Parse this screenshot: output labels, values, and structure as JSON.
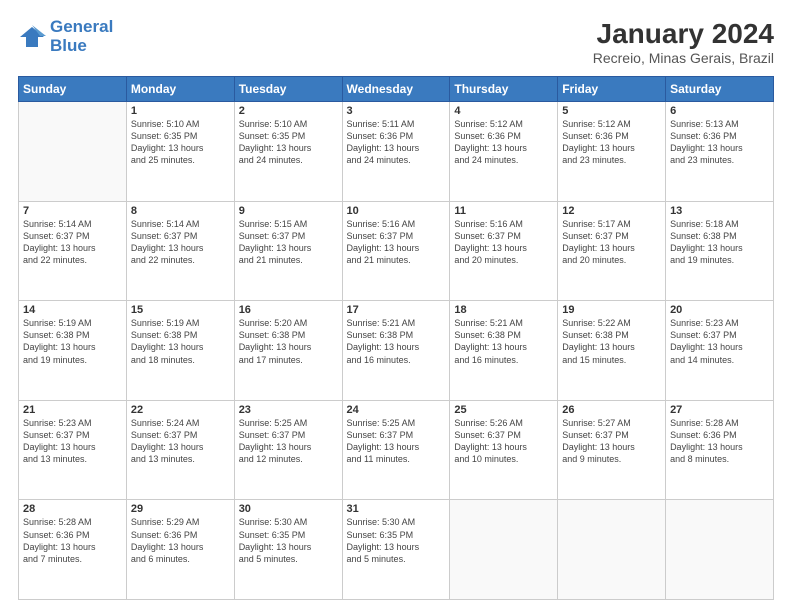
{
  "logo": {
    "line1": "General",
    "line2": "Blue"
  },
  "title": "January 2024",
  "subtitle": "Recreio, Minas Gerais, Brazil",
  "days_of_week": [
    "Sunday",
    "Monday",
    "Tuesday",
    "Wednesday",
    "Thursday",
    "Friday",
    "Saturday"
  ],
  "weeks": [
    [
      {
        "day": "",
        "info": ""
      },
      {
        "day": "1",
        "info": "Sunrise: 5:10 AM\nSunset: 6:35 PM\nDaylight: 13 hours\nand 25 minutes."
      },
      {
        "day": "2",
        "info": "Sunrise: 5:10 AM\nSunset: 6:35 PM\nDaylight: 13 hours\nand 24 minutes."
      },
      {
        "day": "3",
        "info": "Sunrise: 5:11 AM\nSunset: 6:36 PM\nDaylight: 13 hours\nand 24 minutes."
      },
      {
        "day": "4",
        "info": "Sunrise: 5:12 AM\nSunset: 6:36 PM\nDaylight: 13 hours\nand 24 minutes."
      },
      {
        "day": "5",
        "info": "Sunrise: 5:12 AM\nSunset: 6:36 PM\nDaylight: 13 hours\nand 23 minutes."
      },
      {
        "day": "6",
        "info": "Sunrise: 5:13 AM\nSunset: 6:36 PM\nDaylight: 13 hours\nand 23 minutes."
      }
    ],
    [
      {
        "day": "7",
        "info": "Sunrise: 5:14 AM\nSunset: 6:37 PM\nDaylight: 13 hours\nand 22 minutes."
      },
      {
        "day": "8",
        "info": "Sunrise: 5:14 AM\nSunset: 6:37 PM\nDaylight: 13 hours\nand 22 minutes."
      },
      {
        "day": "9",
        "info": "Sunrise: 5:15 AM\nSunset: 6:37 PM\nDaylight: 13 hours\nand 21 minutes."
      },
      {
        "day": "10",
        "info": "Sunrise: 5:16 AM\nSunset: 6:37 PM\nDaylight: 13 hours\nand 21 minutes."
      },
      {
        "day": "11",
        "info": "Sunrise: 5:16 AM\nSunset: 6:37 PM\nDaylight: 13 hours\nand 20 minutes."
      },
      {
        "day": "12",
        "info": "Sunrise: 5:17 AM\nSunset: 6:37 PM\nDaylight: 13 hours\nand 20 minutes."
      },
      {
        "day": "13",
        "info": "Sunrise: 5:18 AM\nSunset: 6:38 PM\nDaylight: 13 hours\nand 19 minutes."
      }
    ],
    [
      {
        "day": "14",
        "info": "Sunrise: 5:19 AM\nSunset: 6:38 PM\nDaylight: 13 hours\nand 19 minutes."
      },
      {
        "day": "15",
        "info": "Sunrise: 5:19 AM\nSunset: 6:38 PM\nDaylight: 13 hours\nand 18 minutes."
      },
      {
        "day": "16",
        "info": "Sunrise: 5:20 AM\nSunset: 6:38 PM\nDaylight: 13 hours\nand 17 minutes."
      },
      {
        "day": "17",
        "info": "Sunrise: 5:21 AM\nSunset: 6:38 PM\nDaylight: 13 hours\nand 16 minutes."
      },
      {
        "day": "18",
        "info": "Sunrise: 5:21 AM\nSunset: 6:38 PM\nDaylight: 13 hours\nand 16 minutes."
      },
      {
        "day": "19",
        "info": "Sunrise: 5:22 AM\nSunset: 6:38 PM\nDaylight: 13 hours\nand 15 minutes."
      },
      {
        "day": "20",
        "info": "Sunrise: 5:23 AM\nSunset: 6:37 PM\nDaylight: 13 hours\nand 14 minutes."
      }
    ],
    [
      {
        "day": "21",
        "info": "Sunrise: 5:23 AM\nSunset: 6:37 PM\nDaylight: 13 hours\nand 13 minutes."
      },
      {
        "day": "22",
        "info": "Sunrise: 5:24 AM\nSunset: 6:37 PM\nDaylight: 13 hours\nand 13 minutes."
      },
      {
        "day": "23",
        "info": "Sunrise: 5:25 AM\nSunset: 6:37 PM\nDaylight: 13 hours\nand 12 minutes."
      },
      {
        "day": "24",
        "info": "Sunrise: 5:25 AM\nSunset: 6:37 PM\nDaylight: 13 hours\nand 11 minutes."
      },
      {
        "day": "25",
        "info": "Sunrise: 5:26 AM\nSunset: 6:37 PM\nDaylight: 13 hours\nand 10 minutes."
      },
      {
        "day": "26",
        "info": "Sunrise: 5:27 AM\nSunset: 6:37 PM\nDaylight: 13 hours\nand 9 minutes."
      },
      {
        "day": "27",
        "info": "Sunrise: 5:28 AM\nSunset: 6:36 PM\nDaylight: 13 hours\nand 8 minutes."
      }
    ],
    [
      {
        "day": "28",
        "info": "Sunrise: 5:28 AM\nSunset: 6:36 PM\nDaylight: 13 hours\nand 7 minutes."
      },
      {
        "day": "29",
        "info": "Sunrise: 5:29 AM\nSunset: 6:36 PM\nDaylight: 13 hours\nand 6 minutes."
      },
      {
        "day": "30",
        "info": "Sunrise: 5:30 AM\nSunset: 6:35 PM\nDaylight: 13 hours\nand 5 minutes."
      },
      {
        "day": "31",
        "info": "Sunrise: 5:30 AM\nSunset: 6:35 PM\nDaylight: 13 hours\nand 5 minutes."
      },
      {
        "day": "",
        "info": ""
      },
      {
        "day": "",
        "info": ""
      },
      {
        "day": "",
        "info": ""
      }
    ]
  ]
}
